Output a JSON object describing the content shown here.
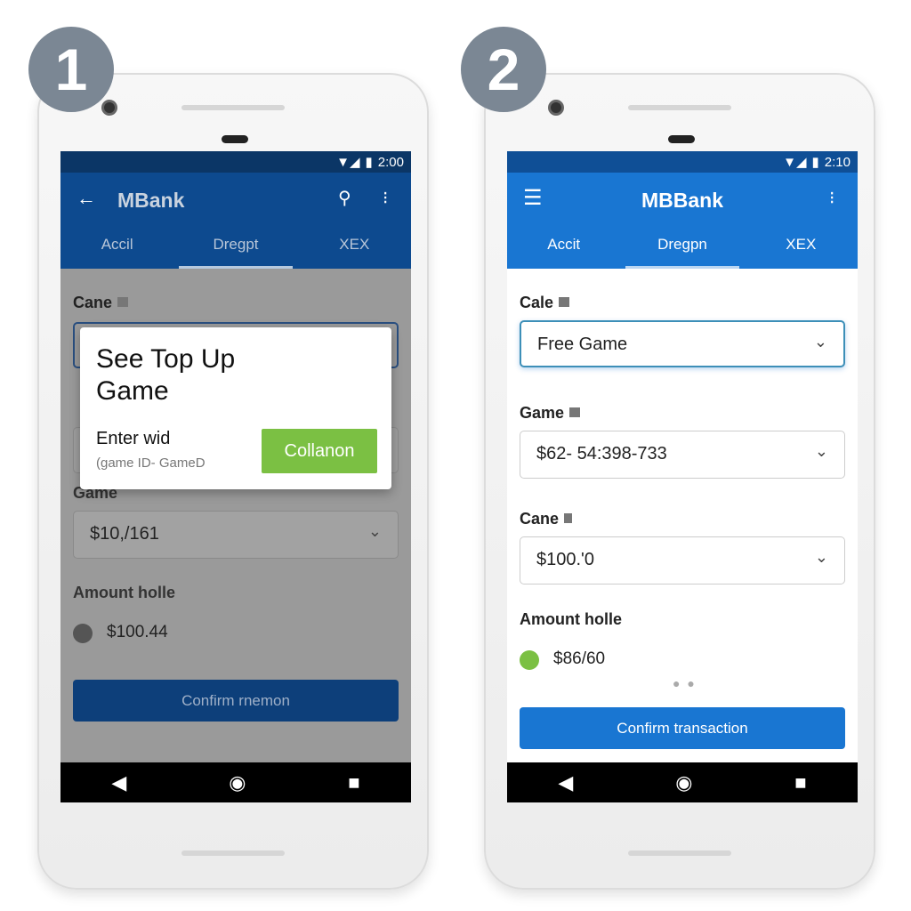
{
  "steps": [
    "1",
    "2"
  ],
  "phone1": {
    "time": "2:00",
    "title": "MBank",
    "tabs": [
      "Accil",
      "Dregpt",
      "XEX"
    ],
    "label1": "Cane",
    "label2": "Game",
    "field2": "$10,/161",
    "amount_label": "Amount holle",
    "amount": "$100.44",
    "confirm": "Confirm rnemon",
    "dialog": {
      "title": "See Top Up Game",
      "prompt": "Enter wid",
      "hint": "(game ID- GameD",
      "action": "Collanon"
    },
    "colors": {
      "appbar": "#0d4a8f",
      "action": "#7bc043"
    }
  },
  "phone2": {
    "time": "2:10",
    "title": "MBBank",
    "tabs": [
      "Accit",
      "Dregpn",
      "XEX"
    ],
    "label1": "Cale",
    "field1": "Free Game",
    "label2": "Game",
    "field2": "$62- 54:398-733",
    "label3": "Cane",
    "field3": "$100.'0",
    "amount_label": "Amount holle",
    "amount": "$86/60",
    "confirm": "Confirm transaction",
    "colors": {
      "appbar": "#1976d2",
      "radio": "#7bc043"
    }
  }
}
